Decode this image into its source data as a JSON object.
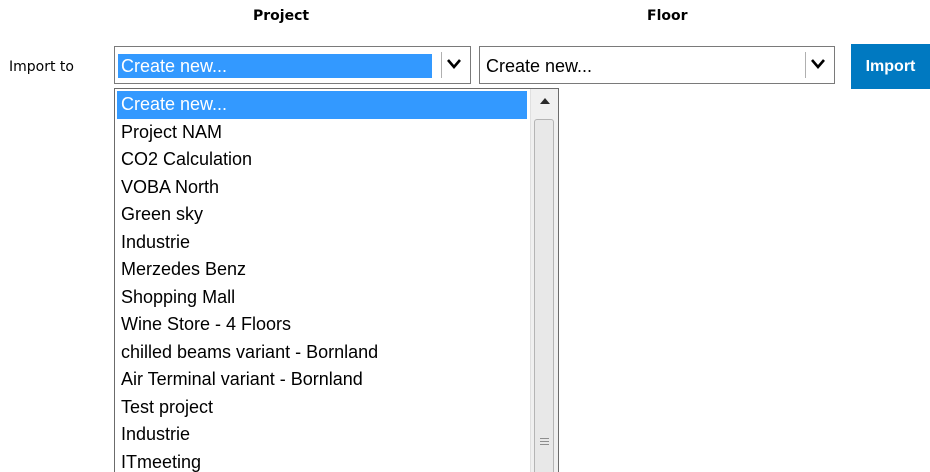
{
  "form": {
    "project_header": "Project",
    "floor_header": "Floor",
    "import_label": "Import to",
    "import_button": "Import"
  },
  "project_select": {
    "value": "Create new...",
    "icon": "chevron-down-icon",
    "options": [
      "Create new...",
      "Project NAM",
      "CO2 Calculation",
      "VOBA North",
      "Green sky",
      "Industrie",
      "Merzedes Benz",
      "Shopping Mall",
      "Wine Store - 4 Floors",
      "chilled beams variant - Bornland",
      "Air Terminal variant - Bornland",
      "Test project",
      "Industrie",
      "ITmeeting"
    ]
  },
  "floor_select": {
    "value": "Create new...",
    "icon": "chevron-down-icon"
  },
  "colors": {
    "selection": "#3399ff",
    "button": "#0079c1"
  }
}
